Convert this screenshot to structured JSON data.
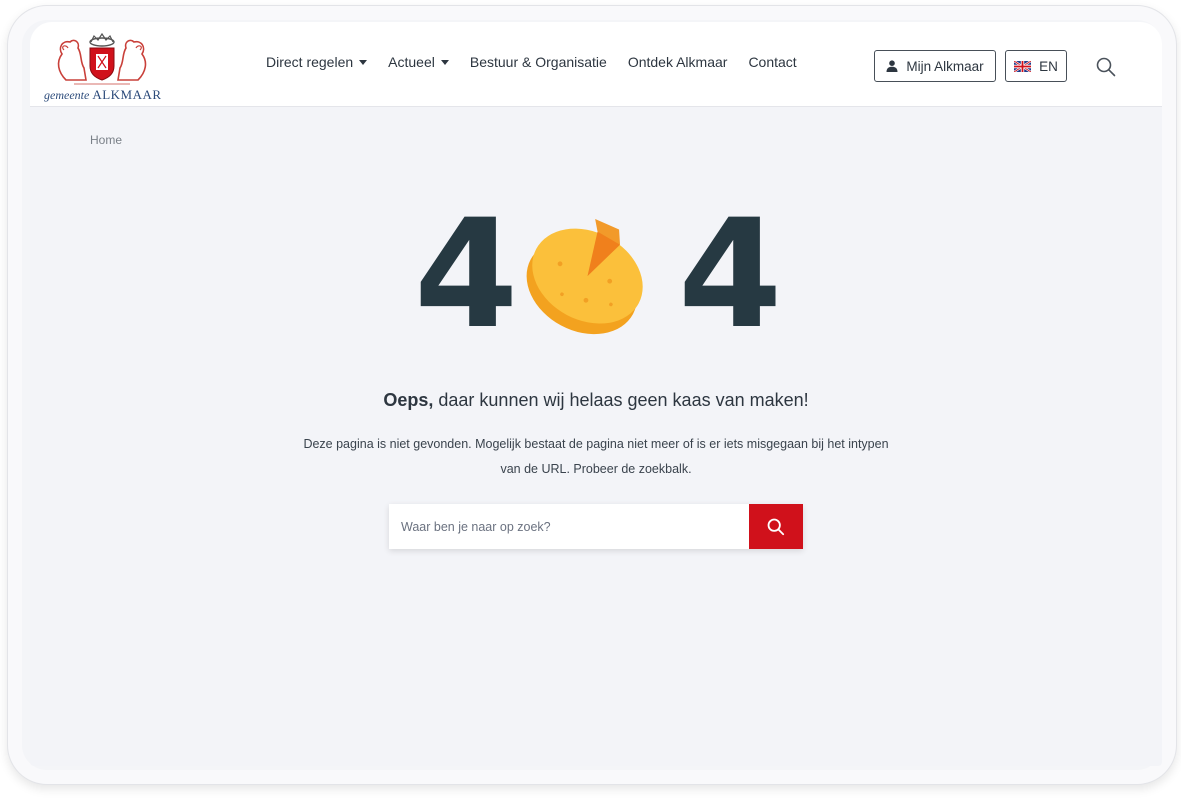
{
  "header": {
    "logo": {
      "icon": "alkmaar-coat-of-arms",
      "prefix": "gemeente",
      "name": "ALKMAAR"
    },
    "nav": [
      {
        "label": "Direct regelen",
        "has_dropdown": true
      },
      {
        "label": "Actueel",
        "has_dropdown": true
      },
      {
        "label": "Bestuur & Organisatie",
        "has_dropdown": false
      },
      {
        "label": "Ontdek Alkmaar",
        "has_dropdown": false
      },
      {
        "label": "Contact",
        "has_dropdown": false
      }
    ],
    "account_button": {
      "label": "Mijn Alkmaar",
      "icon": "user-icon"
    },
    "language_button": {
      "label": "EN",
      "icon": "uk-flag-icon"
    },
    "search_icon": "search-icon"
  },
  "breadcrumb": {
    "home": "Home"
  },
  "error": {
    "code_left": "4",
    "code_right": "4",
    "middle_icon": "cheese-icon",
    "headline_bold": "Oeps,",
    "headline_rest": " daar kunnen wij helaas geen kaas van maken!",
    "description": "Deze pagina is niet gevonden. Mogelijk bestaat de pagina niet meer of is er iets misgegaan bij het intypen van de URL. Probeer de zoekbalk."
  },
  "search": {
    "placeholder": "Waar ben je naar op zoek?",
    "value": "",
    "button_icon": "search-icon"
  },
  "colors": {
    "accent": "#d0111b",
    "text_dark": "#263942",
    "background": "#f3f4f8"
  }
}
